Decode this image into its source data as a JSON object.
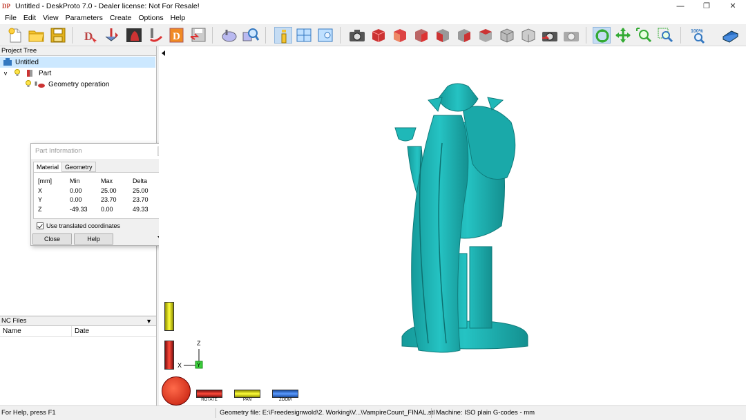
{
  "window": {
    "title": "Untitled - DeskProto 7.0 - Dealer license: Not For Resale!",
    "logo_text": "DP",
    "minimize": "—",
    "restore": "❐",
    "close": "✕"
  },
  "menu": [
    "File",
    "Edit",
    "View",
    "Parameters",
    "Create",
    "Options",
    "Help"
  ],
  "project_tree": {
    "header": "Project Tree",
    "root": "Untitled",
    "part": "Part",
    "operation": "Geometry operation",
    "expand_glyph": "v"
  },
  "nc_files": {
    "header": "NC Files",
    "col_name": "Name",
    "col_date": "Date"
  },
  "part_info": {
    "title": "Part Information",
    "tabs": [
      "Material",
      "Geometry"
    ],
    "header": [
      "[mm]",
      "Min",
      "Max",
      "Delta"
    ],
    "rows": [
      [
        "X",
        "0.00",
        "25.00",
        "25.00"
      ],
      [
        "Y",
        "0.00",
        "23.70",
        "23.70"
      ],
      [
        "Z",
        "-49.33",
        "0.00",
        "49.33"
      ]
    ],
    "checkbox_label": "Use translated coordinates",
    "close_label": "Close",
    "help_label": "Help"
  },
  "viewport": {
    "axis_z": "Z",
    "axis_x": "X",
    "axis_y": "Y",
    "nav_rotate": "ROTATE",
    "nav_pan": "PAN",
    "nav_zoom": "ZOOM",
    "zoom_pct": "100%",
    "model_color": "#1fb8b8"
  },
  "status": {
    "help": "For Help, press F1",
    "geometry": "Geometry file: E:\\Freedesignwold\\2. Working\\V...\\VampireCount_FINAL.stl",
    "machine": "Machine: ISO plain G-codes - mm"
  }
}
